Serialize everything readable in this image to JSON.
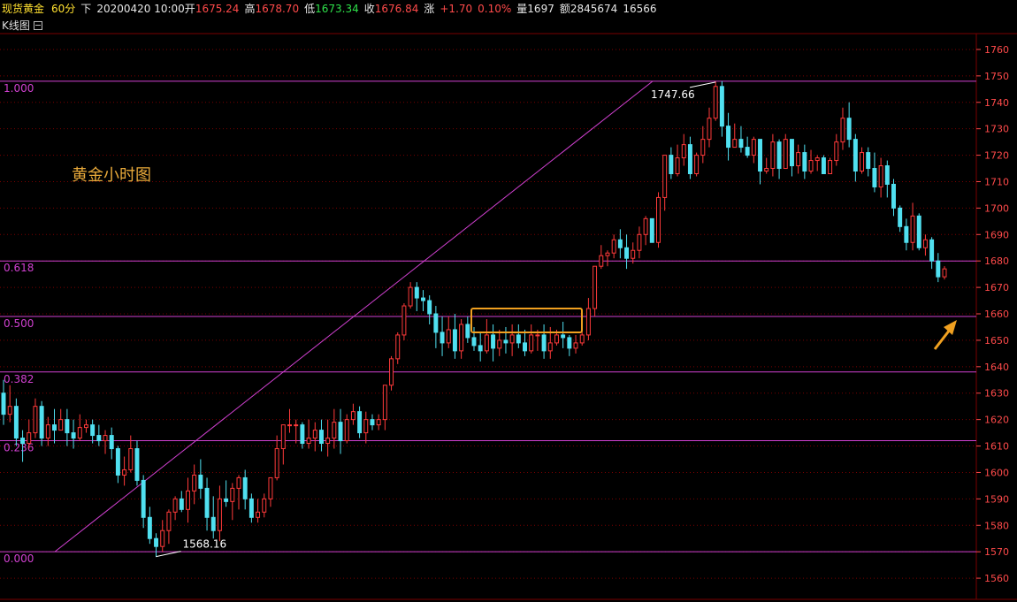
{
  "header": {
    "symbol": "现货黄金",
    "period": "60分",
    "direction": "下",
    "date_time": "20200420 10:00",
    "open_label": "开",
    "open": "1675.24",
    "high_label": "高",
    "high": "1678.70",
    "low_label": "低",
    "low": "1673.34",
    "close_label": "收",
    "close": "1676.84",
    "change_label": "涨",
    "change": "+1.70",
    "change_pct": "0.10%",
    "volume_label": "量",
    "volume": "1697",
    "amount_label": "额",
    "amount": "2845674",
    "extra": "16566"
  },
  "tab": {
    "label": "K线图"
  },
  "colors": {
    "background": "#000000",
    "up": "#ff3a3a",
    "down": "#50e0f0",
    "fib": "#d040d0",
    "grid": "#7a0000",
    "axis_text": "#ff4a4a",
    "annotation": "#e8a93a",
    "box": "#f0a020"
  },
  "chart_data": {
    "type": "candlestick",
    "annotation_text": "黄金小时图",
    "ylim": [
      1552,
      1766
    ],
    "yticks": [
      1560,
      1570,
      1580,
      1590,
      1600,
      1610,
      1620,
      1630,
      1640,
      1650,
      1660,
      1670,
      1680,
      1690,
      1700,
      1710,
      1720,
      1730,
      1740,
      1750,
      1760
    ],
    "fib_levels": [
      {
        "label": "1.000",
        "value": 1748
      },
      {
        "label": "0.618",
        "value": 1680
      },
      {
        "label": "0.500",
        "value": 1659
      },
      {
        "label": "0.382",
        "value": 1638
      },
      {
        "label": "0.236",
        "value": 1612
      },
      {
        "label": "0.000",
        "value": 1570
      }
    ],
    "high_marker": {
      "label": "1747.66",
      "value": 1747.66
    },
    "low_marker": {
      "label": "1568.16",
      "value": 1568.16
    },
    "trend_line": {
      "from": 1570,
      "to": 1748
    },
    "consolidation_box": {
      "low": 1653,
      "high": 1662
    },
    "candles": [
      [
        1630,
        1622,
        1635,
        1618
      ],
      [
        1622,
        1625,
        1633,
        1619
      ],
      [
        1625,
        1613,
        1628,
        1610
      ],
      [
        1613,
        1611,
        1616,
        1604
      ],
      [
        1611,
        1615,
        1620,
        1609
      ],
      [
        1615,
        1625,
        1628,
        1613
      ],
      [
        1625,
        1613,
        1627,
        1610
      ],
      [
        1613,
        1618,
        1621,
        1610
      ],
      [
        1618,
        1616,
        1624,
        1611
      ],
      [
        1616,
        1620,
        1624,
        1616
      ],
      [
        1620,
        1615,
        1624,
        1610
      ],
      [
        1615,
        1613,
        1620,
        1609
      ],
      [
        1613,
        1617,
        1622,
        1612
      ],
      [
        1617,
        1618,
        1620,
        1615
      ],
      [
        1618,
        1614,
        1620,
        1611
      ],
      [
        1614,
        1612,
        1618,
        1610
      ],
      [
        1612,
        1614,
        1616,
        1607
      ],
      [
        1614,
        1609,
        1617,
        1605
      ],
      [
        1609,
        1599,
        1610,
        1596
      ],
      [
        1599,
        1601,
        1606,
        1595
      ],
      [
        1601,
        1609,
        1614,
        1600
      ],
      [
        1609,
        1597,
        1612,
        1595
      ],
      [
        1597,
        1583,
        1599,
        1579
      ],
      [
        1583,
        1575,
        1587,
        1573
      ],
      [
        1575,
        1572,
        1577,
        1568
      ],
      [
        1572,
        1578,
        1582,
        1570
      ],
      [
        1578,
        1585,
        1586,
        1573
      ],
      [
        1585,
        1590,
        1591,
        1582
      ],
      [
        1590,
        1586,
        1593,
        1585
      ],
      [
        1586,
        1593,
        1598,
        1581
      ],
      [
        1593,
        1599,
        1603,
        1588
      ],
      [
        1599,
        1594,
        1605,
        1590
      ],
      [
        1594,
        1583,
        1598,
        1578
      ],
      [
        1583,
        1578,
        1591,
        1575
      ],
      [
        1578,
        1590,
        1595,
        1574
      ],
      [
        1590,
        1589,
        1597,
        1587
      ],
      [
        1589,
        1594,
        1596,
        1582
      ],
      [
        1594,
        1598,
        1599,
        1586
      ],
      [
        1598,
        1590,
        1601,
        1586
      ],
      [
        1590,
        1583,
        1592,
        1581
      ],
      [
        1583,
        1585,
        1590,
        1581
      ],
      [
        1585,
        1590,
        1592,
        1583
      ],
      [
        1590,
        1598,
        1598,
        1587
      ],
      [
        1598,
        1609,
        1614,
        1597
      ],
      [
        1609,
        1618,
        1618,
        1603
      ],
      [
        1618,
        1618,
        1624,
        1615
      ],
      [
        1618,
        1618,
        1620,
        1611
      ],
      [
        1618,
        1611,
        1619,
        1609
      ],
      [
        1611,
        1613,
        1620,
        1609
      ],
      [
        1613,
        1616,
        1619,
        1608
      ],
      [
        1616,
        1611,
        1620,
        1608
      ],
      [
        1611,
        1613,
        1620,
        1606
      ],
      [
        1613,
        1619,
        1624,
        1609
      ],
      [
        1619,
        1612,
        1624,
        1607
      ],
      [
        1612,
        1620,
        1622,
        1611
      ],
      [
        1620,
        1623,
        1626,
        1618
      ],
      [
        1623,
        1615,
        1625,
        1613
      ],
      [
        1615,
        1620,
        1623,
        1611
      ],
      [
        1620,
        1618,
        1622,
        1616
      ],
      [
        1618,
        1620,
        1622,
        1616
      ],
      [
        1620,
        1633,
        1633,
        1616
      ],
      [
        1633,
        1643,
        1644,
        1631
      ],
      [
        1643,
        1652,
        1653,
        1641
      ],
      [
        1652,
        1663,
        1664,
        1650
      ],
      [
        1663,
        1670,
        1672,
        1662
      ],
      [
        1670,
        1666,
        1672,
        1661
      ],
      [
        1666,
        1665,
        1669,
        1661
      ],
      [
        1665,
        1660,
        1667,
        1656
      ],
      [
        1660,
        1653,
        1663,
        1647
      ],
      [
        1653,
        1649,
        1659,
        1644
      ],
      [
        1649,
        1654,
        1659,
        1647
      ],
      [
        1654,
        1646,
        1660,
        1643
      ],
      [
        1646,
        1656,
        1658,
        1643
      ],
      [
        1656,
        1651,
        1659,
        1649
      ],
      [
        1651,
        1648,
        1655,
        1646
      ],
      [
        1648,
        1646,
        1653,
        1642
      ],
      [
        1646,
        1652,
        1658,
        1645
      ],
      [
        1652,
        1647,
        1656,
        1642
      ],
      [
        1647,
        1650,
        1654,
        1644
      ],
      [
        1650,
        1649,
        1655,
        1645
      ],
      [
        1649,
        1652,
        1656,
        1644
      ],
      [
        1652,
        1649,
        1656,
        1647
      ],
      [
        1649,
        1646,
        1654,
        1644
      ],
      [
        1646,
        1652,
        1656,
        1645
      ],
      [
        1652,
        1652,
        1654,
        1646
      ],
      [
        1652,
        1646,
        1656,
        1643
      ],
      [
        1646,
        1649,
        1655,
        1643
      ],
      [
        1649,
        1652,
        1654,
        1648
      ],
      [
        1652,
        1651,
        1657,
        1647
      ],
      [
        1651,
        1647,
        1652,
        1644
      ],
      [
        1647,
        1649,
        1652,
        1645
      ],
      [
        1649,
        1652,
        1654,
        1648
      ],
      [
        1652,
        1662,
        1666,
        1650
      ],
      [
        1662,
        1678,
        1678,
        1659
      ],
      [
        1678,
        1682,
        1686,
        1677
      ],
      [
        1682,
        1683,
        1684,
        1678
      ],
      [
        1683,
        1688,
        1690,
        1681
      ],
      [
        1688,
        1685,
        1692,
        1681
      ],
      [
        1685,
        1681,
        1690,
        1677
      ],
      [
        1681,
        1684,
        1687,
        1679
      ],
      [
        1684,
        1690,
        1693,
        1681
      ],
      [
        1690,
        1696,
        1697,
        1686
      ],
      [
        1696,
        1687,
        1696,
        1687
      ],
      [
        1687,
        1704,
        1706,
        1685
      ],
      [
        1704,
        1720,
        1720,
        1699
      ],
      [
        1720,
        1713,
        1723,
        1711
      ],
      [
        1713,
        1719,
        1724,
        1712
      ],
      [
        1719,
        1724,
        1728,
        1716
      ],
      [
        1724,
        1713,
        1727,
        1711
      ],
      [
        1713,
        1720,
        1721,
        1712
      ],
      [
        1720,
        1726,
        1731,
        1717
      ],
      [
        1726,
        1734,
        1738,
        1723
      ],
      [
        1734,
        1746,
        1748,
        1733
      ],
      [
        1746,
        1731,
        1748,
        1727
      ],
      [
        1731,
        1723,
        1736,
        1718
      ],
      [
        1723,
        1726,
        1732,
        1723
      ],
      [
        1726,
        1723,
        1731,
        1721
      ],
      [
        1723,
        1720,
        1727,
        1719
      ],
      [
        1720,
        1726,
        1727,
        1717
      ],
      [
        1726,
        1714,
        1726,
        1709
      ],
      [
        1714,
        1715,
        1719,
        1713
      ],
      [
        1715,
        1725,
        1728,
        1712
      ],
      [
        1725,
        1715,
        1726,
        1711
      ],
      [
        1715,
        1726,
        1728,
        1715
      ],
      [
        1726,
        1716,
        1726,
        1712
      ],
      [
        1716,
        1721,
        1724,
        1713
      ],
      [
        1721,
        1714,
        1724,
        1711
      ],
      [
        1714,
        1718,
        1722,
        1713
      ],
      [
        1718,
        1719,
        1720,
        1714
      ],
      [
        1719,
        1713,
        1720,
        1713
      ],
      [
        1713,
        1718,
        1719,
        1713
      ],
      [
        1718,
        1725,
        1728,
        1716
      ],
      [
        1725,
        1734,
        1738,
        1722
      ],
      [
        1734,
        1726,
        1740,
        1723
      ],
      [
        1726,
        1714,
        1728,
        1710
      ],
      [
        1714,
        1721,
        1723,
        1713
      ],
      [
        1721,
        1715,
        1723,
        1712
      ],
      [
        1715,
        1708,
        1721,
        1706
      ],
      [
        1708,
        1716,
        1719,
        1704
      ],
      [
        1716,
        1709,
        1718,
        1704
      ],
      [
        1709,
        1700,
        1711,
        1697
      ],
      [
        1700,
        1693,
        1701,
        1691
      ],
      [
        1693,
        1687,
        1696,
        1684
      ],
      [
        1687,
        1697,
        1702,
        1684
      ],
      [
        1697,
        1685,
        1698,
        1684
      ],
      [
        1685,
        1688,
        1690,
        1682
      ],
      [
        1688,
        1680,
        1689,
        1677
      ],
      [
        1680,
        1674,
        1683,
        1672
      ],
      [
        1674,
        1677,
        1678,
        1673
      ]
    ]
  }
}
